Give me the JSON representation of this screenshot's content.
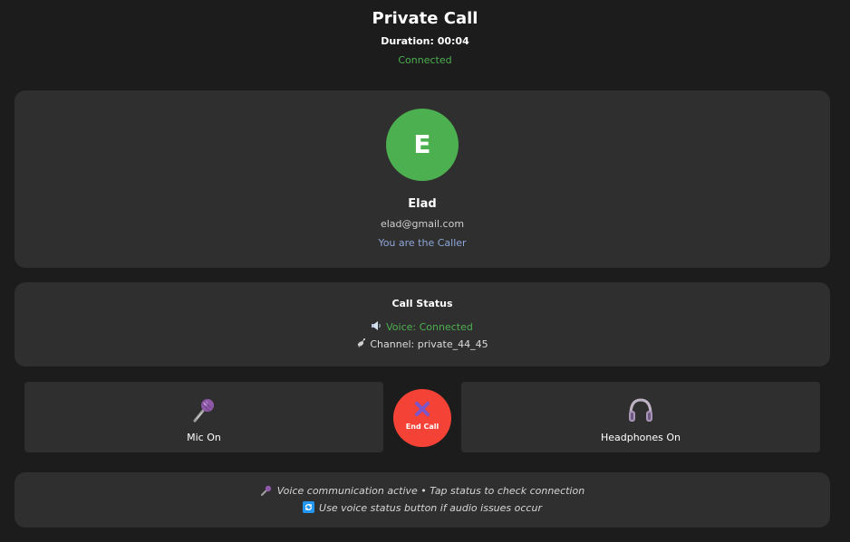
{
  "header": {
    "title": "Private Call",
    "duration": "Duration: 00:04",
    "status": "Connected"
  },
  "profile": {
    "avatar_initial": "E",
    "name": "Elad",
    "email": "elad@gmail.com",
    "role": "You are the Caller"
  },
  "call_status": {
    "title": "Call Status",
    "voice_icon": "speaker-icon",
    "voice": "Voice: Connected",
    "channel_icon": "satellite-icon",
    "channel": "Channel: private_44_45"
  },
  "controls": {
    "mic": {
      "icon": "microphone-icon",
      "label": "Mic On"
    },
    "end_call": {
      "icon": "x-icon",
      "label": "End Call"
    },
    "headphones": {
      "icon": "headphones-icon",
      "label": "Headphones On"
    }
  },
  "tips": {
    "line1": "Voice communication active • Tap status to check connection",
    "line2": "Use voice status button if audio issues occur"
  },
  "colors": {
    "background": "#1c1c1c",
    "card": "#2f2f2f",
    "success": "#4caf50",
    "danger": "#f44336",
    "role": "#8ea6d8"
  }
}
